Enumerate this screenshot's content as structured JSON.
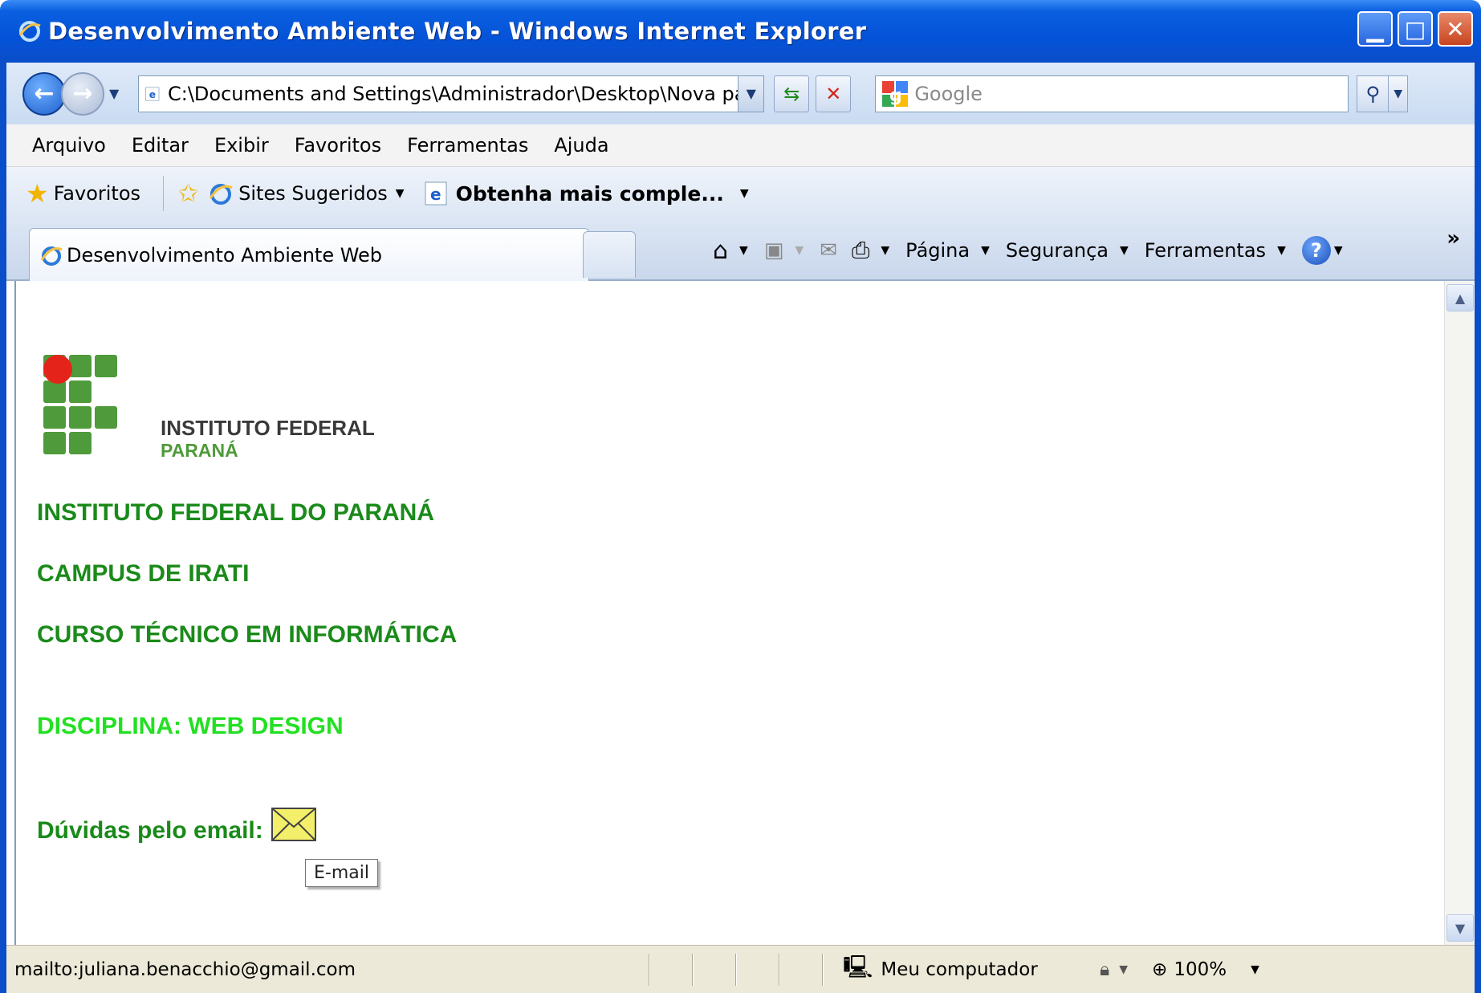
{
  "window": {
    "title": "Desenvolvimento Ambiente Web - Windows Internet Explorer"
  },
  "address_bar": {
    "url": "C:\\Documents and Settings\\Administrador\\Desktop\\Nova past",
    "search_placeholder": "Google"
  },
  "menu": {
    "items": [
      "Arquivo",
      "Editar",
      "Exibir",
      "Favoritos",
      "Ferramentas",
      "Ajuda"
    ]
  },
  "favorites_bar": {
    "favorites_label": "Favoritos",
    "sites_label": "Sites Sugeridos",
    "obtenha_label": "Obtenha mais comple..."
  },
  "tabs": {
    "active_label": "Desenvolvimento Ambiente Web"
  },
  "command_bar": {
    "pagina": "Página",
    "seguranca": "Segurança",
    "ferramentas": "Ferramentas",
    "more": "»"
  },
  "page": {
    "logo_line1": "INSTITUTO FEDERAL",
    "logo_line2": "PARANÁ",
    "heading_institute": "INSTITUTO FEDERAL DO PARANÁ",
    "heading_campus": "CAMPUS DE IRATI",
    "heading_course": "CURSO TÉCNICO EM INFORMÁTICA",
    "heading_discipline": "DISCIPLINA: WEB DESIGN",
    "questions_label": "Dúvidas pelo email:",
    "tooltip": "E-mail"
  },
  "status_bar": {
    "text": "mailto:juliana.benacchio@gmail.com",
    "zone": "Meu computador",
    "zoom": "100%"
  },
  "colors": {
    "heading_green": "#1a8a1a",
    "discipline_green": "#22e022",
    "logo_red": "#e4231b",
    "logo_green": "#4f9a3a"
  }
}
